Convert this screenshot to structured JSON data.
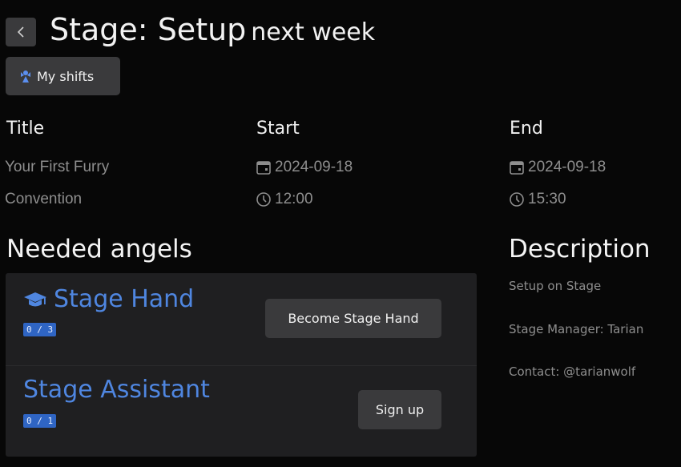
{
  "header": {
    "title": "Stage: Setup",
    "subtitle": "next week",
    "my_shifts_label": "My shifts"
  },
  "info": {
    "title_heading": "Title",
    "title_value_line1": "Your First Furry",
    "title_value_line2": "Convention",
    "start_heading": "Start",
    "start_date": "2024-09-18",
    "start_time": "12:00",
    "end_heading": "End",
    "end_date": "2024-09-18",
    "end_time": "15:30"
  },
  "needed_angels": {
    "heading": "Needed angels",
    "rows": [
      {
        "name": "Stage Hand",
        "count": "0 / 3",
        "action_label": "Become Stage Hand",
        "icon": "graduation-cap-icon"
      },
      {
        "name": "Stage Assistant",
        "count": "0 / 1",
        "action_label": "Sign up"
      }
    ]
  },
  "description": {
    "heading": "Description",
    "lines": [
      "Setup on Stage",
      "Stage Manager: Tarian",
      "Contact: @tarianwolf"
    ]
  },
  "colors": {
    "background": "#070707",
    "panel": "#1f1f21",
    "button": "#3a3a3c",
    "link_blue": "#4f86e0",
    "badge_blue": "#2f65c4",
    "muted_text": "#8e8e8e"
  }
}
